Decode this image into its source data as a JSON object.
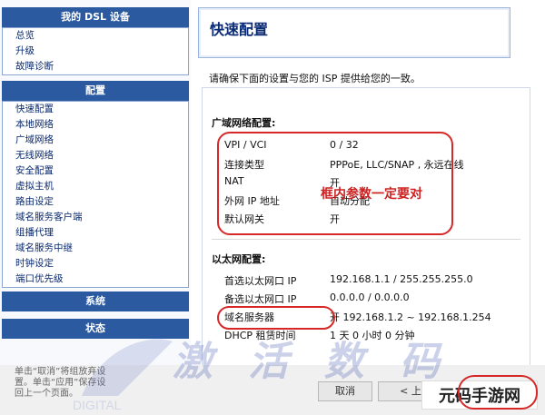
{
  "sidebar": {
    "panel1_title": "我的 DSL 设备",
    "panel1_items": [
      "总览",
      "升级",
      "故障诊断"
    ],
    "panel2_title": "配置",
    "panel2_items": [
      "快速配置",
      "本地网络",
      "广域网络",
      "无线网络",
      "安全配置",
      "虚拟主机",
      "路由设定",
      "域名服务客户端",
      "组播代理",
      "域名服务中继",
      "时钟设定",
      "端口优先级"
    ],
    "panel3_title": "系统",
    "panel4_title": "状态"
  },
  "main": {
    "title": "快速配置",
    "intro": "请确保下面的设置与您的 ISP 提供给您的一致。",
    "annotation": "框内参数一定要对",
    "wan_title": "广域网络配置:",
    "wan_rows": [
      {
        "label": "VPI / VCI",
        "value": "0 / 32"
      },
      {
        "label": "连接类型",
        "value": "PPPoE,   LLC/SNAP  , 永远在线"
      },
      {
        "label": "NAT",
        "value": "开"
      },
      {
        "label": "外网 IP 地址",
        "value": "自动分配"
      },
      {
        "label": "默认网关",
        "value": "开"
      }
    ],
    "lan_title": "以太网配置:",
    "lan_rows": [
      {
        "label": "首选以太网口 IP",
        "value": "192.168.1.1 / 255.255.255.0"
      },
      {
        "label": "备选以太网口 IP",
        "value": "0.0.0.0 / 0.0.0.0"
      },
      {
        "label": "域名服务器",
        "value": "开  192.168.1.2 ~ 192.168.1.254"
      },
      {
        "label": "DHCP 租赁时间",
        "value": "1 天 0 小时 0 分钟"
      }
    ]
  },
  "footer": {
    "note_lines": [
      "单击“取消”将组放弃设",
      "置。单击“应用”保存设",
      "回上一个页面。"
    ],
    "cancel_button": "取消",
    "prev_button": "< 上",
    "watermark_text": "激 活 数 码",
    "digital_text": "DIGITAL",
    "brand_text": "元码手游网"
  },
  "colors": {
    "sidebar_header": "#2c5aa0",
    "title_text": "#0b2b73",
    "highlight_red": "#d62828"
  }
}
